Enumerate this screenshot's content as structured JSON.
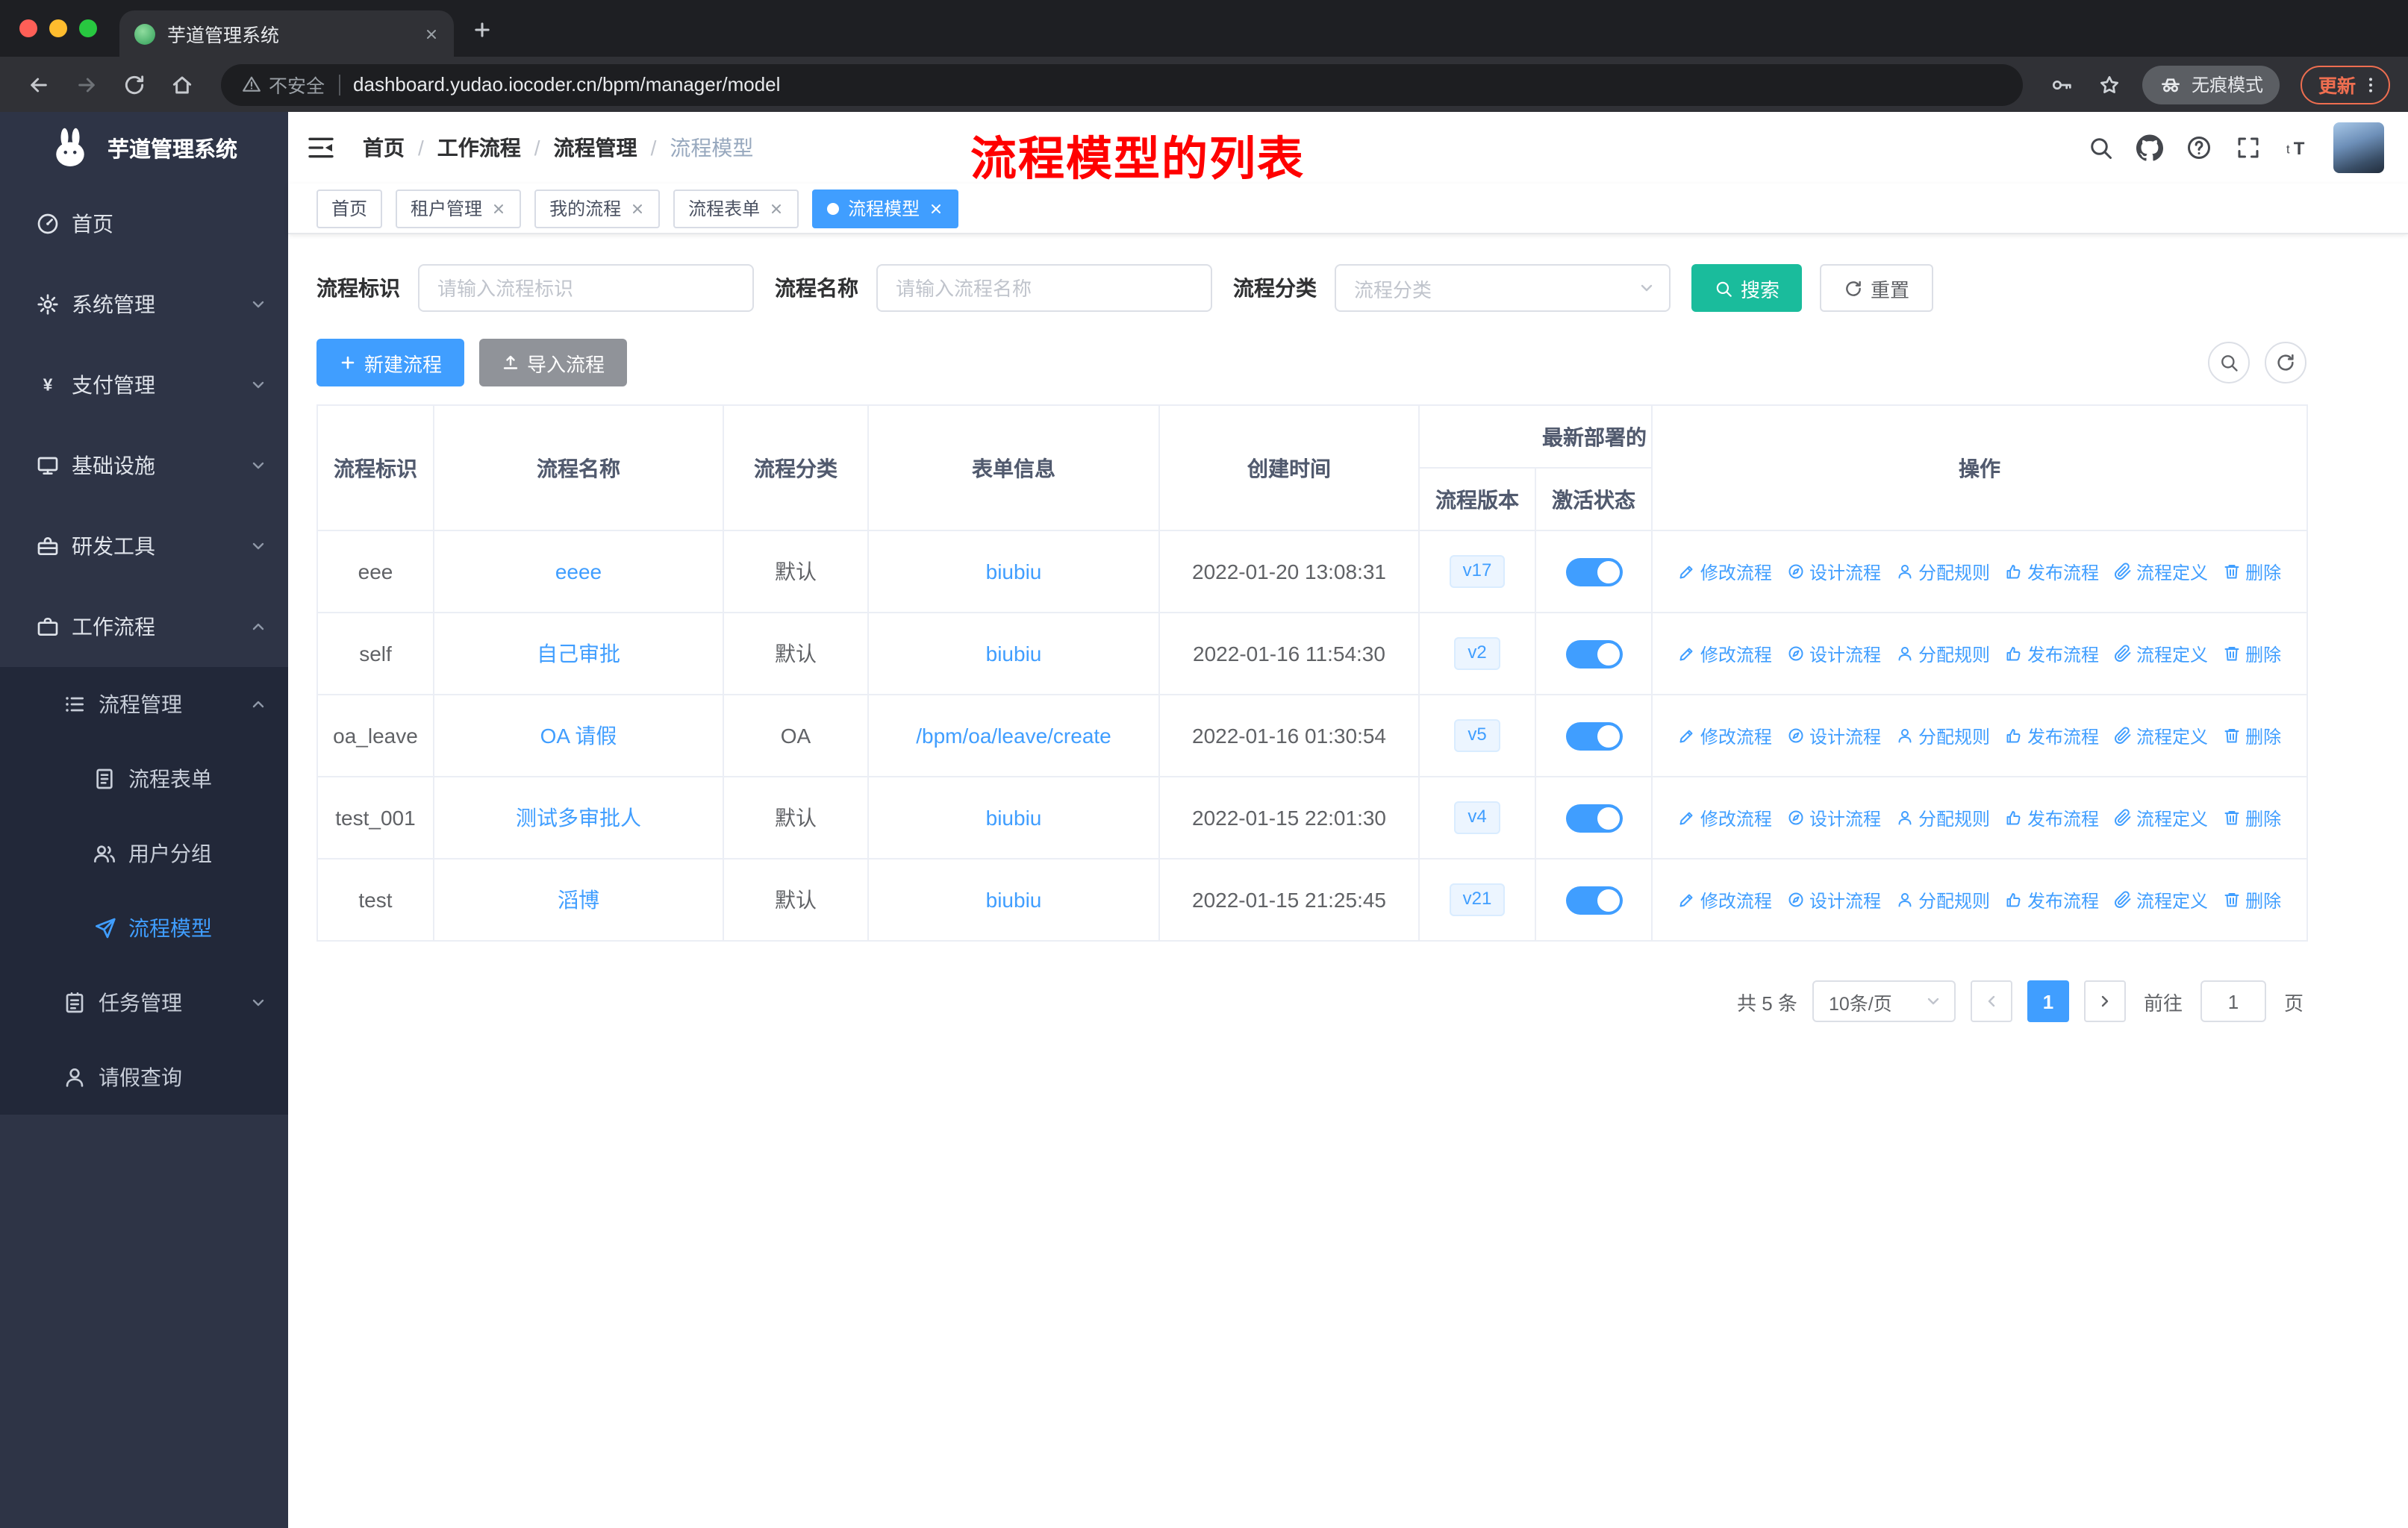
{
  "browser": {
    "tab_title": "芋道管理系统",
    "security_text": "不安全",
    "url": "dashboard.yudao.iocoder.cn/bpm/manager/model",
    "incognito_label": "无痕模式",
    "update_label": "更新"
  },
  "annotation": {
    "text": "流程模型的列表"
  },
  "sidebar": {
    "logo_title": "芋道管理系统",
    "menu": [
      {
        "label": "首页"
      },
      {
        "label": "系统管理"
      },
      {
        "label": "支付管理"
      },
      {
        "label": "基础设施"
      },
      {
        "label": "研发工具"
      },
      {
        "label": "工作流程"
      },
      {
        "label": "流程管理"
      },
      {
        "label": "流程表单"
      },
      {
        "label": "用户分组"
      },
      {
        "label": "流程模型"
      },
      {
        "label": "任务管理"
      },
      {
        "label": "请假查询"
      }
    ]
  },
  "header": {
    "breadcrumb": [
      "首页",
      "工作流程",
      "流程管理",
      "流程模型"
    ]
  },
  "tags": [
    {
      "label": "首页",
      "closable": false,
      "active": false
    },
    {
      "label": "租户管理",
      "closable": true,
      "active": false
    },
    {
      "label": "我的流程",
      "closable": true,
      "active": false
    },
    {
      "label": "流程表单",
      "closable": true,
      "active": false
    },
    {
      "label": "流程模型",
      "closable": true,
      "active": true
    }
  ],
  "filters": {
    "key_label": "流程标识",
    "key_placeholder": "请输入流程标识",
    "name_label": "流程名称",
    "name_placeholder": "请输入流程名称",
    "category_label": "流程分类",
    "category_placeholder": "流程分类",
    "search_label": "搜索",
    "reset_label": "重置"
  },
  "toolbar": {
    "create_label": "新建流程",
    "import_label": "导入流程"
  },
  "table": {
    "headers": {
      "key": "流程标识",
      "name": "流程名称",
      "category": "流程分类",
      "form": "表单信息",
      "created": "创建时间",
      "deploy_group": "最新部署的",
      "version": "流程版本",
      "active": "激活状态",
      "actions": "操作"
    },
    "action_labels": [
      "修改流程",
      "设计流程",
      "分配规则",
      "发布流程",
      "流程定义",
      "删除"
    ],
    "rows": [
      {
        "key": "eee",
        "name": "eeee",
        "category": "默认",
        "form": "biubiu",
        "created": "2022-01-20 13:08:31",
        "version": "v17",
        "enabled": true
      },
      {
        "key": "self",
        "name": "自己审批",
        "category": "默认",
        "form": "biubiu",
        "created": "2022-01-16 11:54:30",
        "version": "v2",
        "enabled": true
      },
      {
        "key": "oa_leave",
        "name": "OA 请假",
        "category": "OA",
        "form": "/bpm/oa/leave/create",
        "created": "2022-01-16 01:30:54",
        "version": "v5",
        "enabled": true
      },
      {
        "key": "test_001",
        "name": "测试多审批人",
        "category": "默认",
        "form": "biubiu",
        "created": "2022-01-15 22:01:30",
        "version": "v4",
        "enabled": true
      },
      {
        "key": "test",
        "name": "滔博",
        "category": "默认",
        "form": "biubiu",
        "created": "2022-01-15 21:25:45",
        "version": "v21",
        "enabled": true
      }
    ]
  },
  "pagination": {
    "total": "共 5 条",
    "page_size": "10条/页",
    "page": "1",
    "goto_label": "前往",
    "goto_value": "1",
    "unit_label": "页"
  },
  "colors": {
    "accent": "#409eff",
    "search_button": "#1abc9c",
    "annotation": "#ff0000",
    "sidebar_bg": "#2e3446",
    "submenu_bg": "#222839"
  }
}
